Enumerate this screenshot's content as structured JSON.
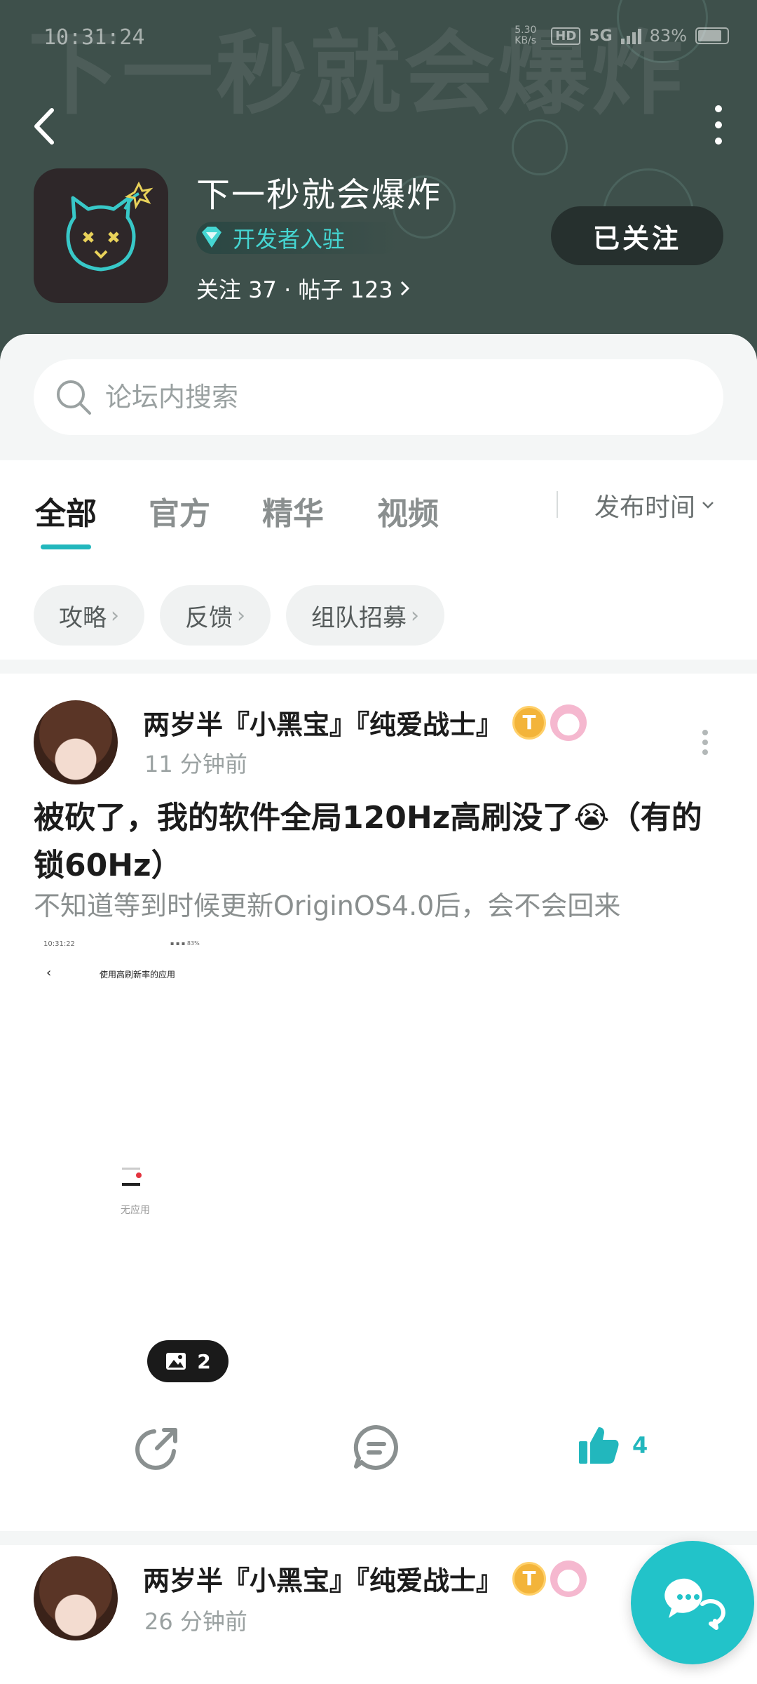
{
  "status_bar": {
    "time": "10:31:24",
    "net_speed": "5.30 KB/s",
    "hd": "HD",
    "signal": "5G",
    "battery": "83%",
    "battery_level": 0.83
  },
  "header": {
    "watermark": "下一秒就会爆炸",
    "title": "下一秒就会爆炸",
    "dev_badge": "开发者入驻",
    "stats": "关注 37 · 帖子 123",
    "follow_button": "已关注"
  },
  "search": {
    "placeholder": "论坛内搜索"
  },
  "tabs": [
    {
      "label": "全部",
      "active": true
    },
    {
      "label": "官方",
      "active": false
    },
    {
      "label": "精华",
      "active": false
    },
    {
      "label": "视频",
      "active": false
    }
  ],
  "sort_label": "发布时间",
  "chips": [
    "攻略",
    "反馈",
    "组队招募"
  ],
  "posts": [
    {
      "author": "两岁半『小黑宝』『纯爱战士』",
      "time": "11 分钟前",
      "title": "被砍了，我的软件全局120Hz高刷没了😭（有的锁60Hz）",
      "subtitle": "不知道等到时候更新OriginOS4.0后，会不会回来",
      "image": {
        "time": "10:31:22",
        "status": "▪ ▪ ▪ 83%",
        "title": "使用高刷新率的应用",
        "empty_text": "无应用"
      },
      "image_count": "2",
      "likes": "4"
    },
    {
      "author": "两岁半『小黑宝』『纯爱战士』",
      "time": "26 分钟前"
    }
  ],
  "colors": {
    "accent": "#22b7bd",
    "header_bg": "#3e504b",
    "dev_badge": "#45d6d2"
  }
}
